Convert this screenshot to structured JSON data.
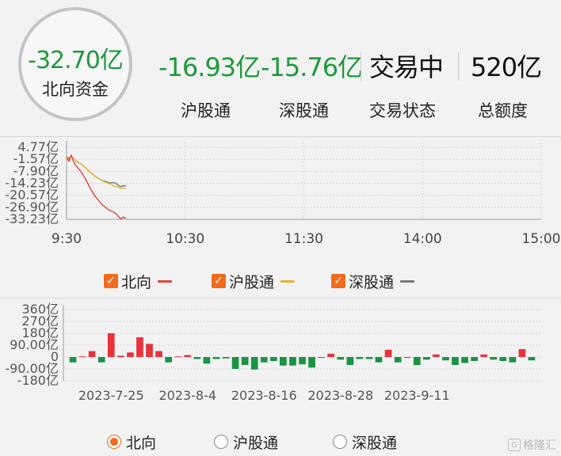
{
  "summary": {
    "north_value": "-32.70亿",
    "north_label": "北向资金",
    "stats": [
      {
        "value": "-16.93亿",
        "label": "沪股通",
        "color": "#1e9a3c"
      },
      {
        "value": "-15.76亿",
        "label": "深股通",
        "color": "#1e9a3c"
      },
      {
        "value": "交易中",
        "label": "交易状态",
        "color": "#111111"
      },
      {
        "value": "520亿",
        "label": "总额度",
        "color": "#111111"
      }
    ]
  },
  "legend": [
    {
      "label": "北向",
      "color": "#e8413c",
      "checked": true
    },
    {
      "label": "沪股通",
      "color": "#e8b62d",
      "checked": true
    },
    {
      "label": "深股通",
      "color": "#777777",
      "checked": true
    }
  ],
  "radios": [
    {
      "label": "北向",
      "selected": true
    },
    {
      "label": "沪股通",
      "selected": false
    },
    {
      "label": "深股通",
      "selected": false
    }
  ],
  "watermark": "格隆汇",
  "colors": {
    "up": "#e8323c",
    "down": "#1a9443",
    "accent": "#f26a1b"
  },
  "chart_data": [
    {
      "type": "line",
      "x_ticks": [
        "9:30",
        "10:30",
        "11:30",
        "14:00",
        "15:00"
      ],
      "y_ticks": [
        "4.77亿",
        "-1.57亿",
        "-7.90亿",
        "-14.23亿",
        "-20.57亿",
        "-26.90亿",
        "-33.23亿"
      ],
      "ylim": [
        -33.23,
        4.77
      ],
      "x_range_minutes": [
        0,
        240
      ],
      "grid": true,
      "series": [
        {
          "name": "北向",
          "color": "#e8413c",
          "x": [
            0,
            1,
            2,
            3,
            4,
            5,
            6,
            7,
            8,
            9,
            10,
            11,
            12,
            13,
            14,
            15,
            16,
            17,
            18,
            19,
            20,
            21,
            22,
            23,
            24,
            25
          ],
          "y": [
            -0.8,
            -2.5,
            0.5,
            -3.0,
            -5.0,
            -6.5,
            -8.0,
            -10.0,
            -12.0,
            -14.5,
            -17.0,
            -19.0,
            -21.0,
            -22.5,
            -24.0,
            -25.5,
            -26.5,
            -27.5,
            -28.5,
            -29.0,
            -29.5,
            -30.5,
            -32.0,
            -33.0,
            -32.0,
            -32.7
          ]
        },
        {
          "name": "沪股通",
          "color": "#e8b62d",
          "x": [
            0,
            1,
            2,
            3,
            4,
            5,
            6,
            7,
            8,
            9,
            10,
            11,
            12,
            13,
            14,
            15,
            16,
            17,
            18,
            19,
            20,
            21,
            22,
            23,
            24,
            25
          ],
          "y": [
            -0.5,
            -1.5,
            0.3,
            -1.5,
            -2.5,
            -3.2,
            -4.0,
            -5.0,
            -6.0,
            -7.2,
            -8.5,
            -9.5,
            -10.5,
            -11.2,
            -12.0,
            -12.8,
            -13.4,
            -14.0,
            -14.5,
            -15.0,
            -15.6,
            -16.0,
            -16.5,
            -17.0,
            -16.6,
            -16.93
          ]
        },
        {
          "name": "深股通",
          "color": "#777777",
          "x": [
            0,
            1,
            2,
            3,
            4,
            5,
            6,
            7,
            8,
            9,
            10,
            11,
            12,
            13,
            14,
            15,
            16,
            17,
            18,
            19,
            20,
            21,
            22,
            23,
            24,
            25
          ],
          "y": [
            -0.3,
            -1.0,
            0.2,
            -1.5,
            -2.5,
            -3.3,
            -4.0,
            -5.0,
            -6.0,
            -7.3,
            -8.5,
            -9.5,
            -10.5,
            -11.3,
            -12.0,
            -12.7,
            -13.1,
            -13.5,
            -14.0,
            -14.0,
            -13.9,
            -14.5,
            -15.5,
            -16.0,
            -15.4,
            -15.76
          ]
        }
      ]
    },
    {
      "type": "bar",
      "x_tick_labels": [
        "2023-7-25",
        "2023-8-4",
        "2023-8-16",
        "2023-8-28",
        "2023-9-11"
      ],
      "x_tick_index": [
        4,
        12,
        20,
        28,
        36
      ],
      "y_ticks": [
        "360亿",
        "270亿",
        "180亿",
        "90.00亿",
        "0",
        "-90.00亿",
        "-180亿"
      ],
      "ylim": [
        -180,
        360
      ],
      "grid": true,
      "series": [
        {
          "name": "北向",
          "values": [
            -40,
            5,
            45,
            -40,
            180,
            10,
            35,
            150,
            100,
            45,
            -40,
            5,
            15,
            -15,
            -50,
            -15,
            -10,
            -90,
            -60,
            -95,
            -40,
            -30,
            -65,
            -65,
            -55,
            -80,
            -5,
            25,
            -20,
            -60,
            -15,
            -15,
            -40,
            55,
            -40,
            -5,
            -60,
            -20,
            20,
            -25,
            -60,
            -45,
            -30,
            20,
            -20,
            -30,
            -40,
            60,
            -25
          ]
        }
      ]
    }
  ]
}
